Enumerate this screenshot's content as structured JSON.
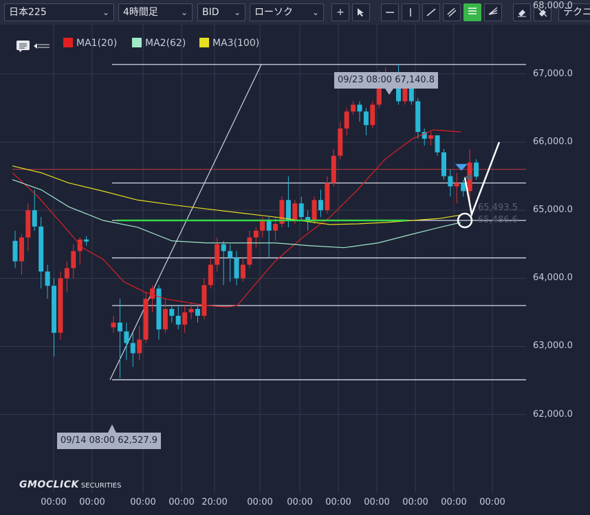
{
  "toolbar": {
    "symbol": "日本225",
    "timeframe": "4時間足",
    "price_side": "BID",
    "chart_type": "ローソク",
    "right_cut_label": "テクニ"
  },
  "legend": {
    "ma1": "MA1(20)",
    "ma2": "MA2(62)",
    "ma3": "MA3(100)"
  },
  "colors": {
    "background": "#1d2235",
    "toolbar": "#262b3d",
    "up": "#e03030",
    "down": "#29b8d8",
    "ma1": "#e02020",
    "ma2": "#a0e8c8",
    "ma3": "#e6e020",
    "horizontal_line": "#d8dce6",
    "current_price_line": "#c03a3a",
    "green_line": "#39d84a",
    "grid": "#353b4f"
  },
  "callouts": {
    "high": "09/23 08:00 67,140.8",
    "low": "09/14 08:00 62,527.9"
  },
  "price_labels": {
    "upper": "65,493.5",
    "lower": "65,486.6"
  },
  "brand": {
    "name": "GMOCLICK",
    "suffix": "SECURITIES"
  },
  "chart_data": {
    "type": "candlestick",
    "y_ticks": [
      "68,000.0",
      "67,000.0",
      "66,000.0",
      "65,000.0",
      "64,000.0",
      "63,000.0",
      "62,000.0"
    ],
    "x_ticks": [
      "00:00",
      "00:00",
      "00:00",
      "00:00",
      "20:00",
      "00:00",
      "00:00",
      "00:00",
      "00:00",
      "00:00",
      "00:00",
      "00:00"
    ],
    "ylim": [
      61800,
      68150
    ],
    "horizontal_lines": [
      67140.8,
      65400,
      64850,
      64300,
      63600,
      62510
    ],
    "current_price": 65600,
    "candles": [
      [
        64550,
        64250,
        64700,
        64150
      ],
      [
        64250,
        64600,
        64650,
        64050
      ],
      [
        64600,
        65000,
        65100,
        64400
      ],
      [
        65000,
        64760,
        65300,
        64700
      ],
      [
        64760,
        64100,
        64900,
        63850
      ],
      [
        64100,
        63890,
        64200,
        63700
      ],
      [
        63890,
        63200,
        64000,
        62850
      ],
      [
        63200,
        64000,
        64100,
        63100
      ],
      [
        64000,
        64150,
        64250,
        63800
      ],
      [
        64150,
        64400,
        64500,
        64000
      ],
      [
        64400,
        64570,
        64600,
        64200
      ],
      [
        64570,
        64540,
        64620,
        64480
      ],
      [
        63280,
        63350,
        63450,
        63200
      ],
      [
        63350,
        63220,
        63700,
        62530
      ],
      [
        63220,
        63050,
        63350,
        62800
      ],
      [
        63050,
        62900,
        63200,
        62700
      ],
      [
        62900,
        63100,
        63300,
        62800
      ],
      [
        63100,
        63700,
        63800,
        63050
      ],
      [
        63700,
        63850,
        63900,
        63500
      ],
      [
        63850,
        63250,
        63900,
        63100
      ],
      [
        63250,
        63550,
        63700,
        63200
      ],
      [
        63550,
        63450,
        63600,
        63350
      ],
      [
        63450,
        63320,
        63600,
        63250
      ],
      [
        63320,
        63500,
        63600,
        63200
      ],
      [
        63500,
        63550,
        63650,
        63400
      ],
      [
        63550,
        63450,
        63600,
        63350
      ],
      [
        63450,
        63900,
        64000,
        63400
      ],
      [
        63900,
        64200,
        64300,
        63850
      ],
      [
        64200,
        64500,
        64600,
        64100
      ],
      [
        64500,
        64400,
        64550,
        63900
      ],
      [
        64400,
        64300,
        64500,
        63950
      ],
      [
        64300,
        64000,
        64400,
        63900
      ],
      [
        64000,
        64200,
        64300,
        63950
      ],
      [
        64200,
        64600,
        64700,
        64150
      ],
      [
        64600,
        64700,
        64750,
        64450
      ],
      [
        64700,
        64850,
        64900,
        64600
      ],
      [
        64850,
        64700,
        64900,
        64300
      ],
      [
        64700,
        64800,
        64900,
        64550
      ],
      [
        64800,
        65150,
        65200,
        64750
      ],
      [
        65150,
        64850,
        65500,
        64750
      ],
      [
        64850,
        65100,
        65150,
        64800
      ],
      [
        65100,
        64900,
        65200,
        64850
      ],
      [
        64900,
        64850,
        65000,
        64700
      ],
      [
        64850,
        65150,
        65200,
        64800
      ],
      [
        65150,
        65000,
        65300,
        64900
      ],
      [
        65000,
        65400,
        65500,
        64950
      ],
      [
        65400,
        65800,
        65900,
        65350
      ],
      [
        65800,
        66200,
        66300,
        65750
      ],
      [
        66200,
        66450,
        66500,
        66100
      ],
      [
        66450,
        66550,
        66600,
        66400
      ],
      [
        66550,
        66450,
        66600,
        66300
      ],
      [
        66450,
        66250,
        66500,
        66100
      ],
      [
        66250,
        66550,
        66600,
        66200
      ],
      [
        66550,
        66900,
        67050,
        66500
      ],
      [
        66900,
        66950,
        67100,
        66850
      ],
      [
        66950,
        66850,
        67000,
        66800
      ],
      [
        66850,
        66600,
        67140.8,
        66550
      ],
      [
        66600,
        66800,
        66850,
        66550
      ],
      [
        66800,
        66600,
        66850,
        66550
      ],
      [
        66600,
        66150,
        66650,
        66050
      ],
      [
        66150,
        66050,
        66200,
        65950
      ],
      [
        66050,
        66100,
        66150,
        65950
      ],
      [
        66100,
        65850,
        66100,
        65800
      ],
      [
        65850,
        65500,
        65900,
        65450
      ],
      [
        65500,
        65350,
        65600,
        65200
      ],
      [
        65350,
        65400,
        65550,
        65100
      ],
      [
        65400,
        65280,
        65450,
        65200
      ],
      [
        65280,
        65700,
        65900,
        65100
      ],
      [
        65700,
        65493.5,
        65750,
        65450
      ]
    ],
    "ma1": [
      [
        18,
        65550
      ],
      [
        55,
        65200
      ],
      [
        90,
        64800
      ],
      [
        120,
        64450
      ],
      [
        150,
        64280
      ],
      [
        180,
        63950
      ],
      [
        210,
        63800
      ],
      [
        240,
        63700
      ],
      [
        270,
        63650
      ],
      [
        300,
        63600
      ],
      [
        330,
        63580
      ],
      [
        345,
        63600
      ],
      [
        370,
        63900
      ],
      [
        400,
        64250
      ],
      [
        440,
        64600
      ],
      [
        480,
        64900
      ],
      [
        520,
        65300
      ],
      [
        560,
        65750
      ],
      [
        600,
        66050
      ],
      [
        630,
        66180
      ],
      [
        670,
        66150
      ]
    ],
    "ma2": [
      [
        18,
        65450
      ],
      [
        60,
        65300
      ],
      [
        100,
        65050
      ],
      [
        150,
        64850
      ],
      [
        200,
        64750
      ],
      [
        250,
        64550
      ],
      [
        300,
        64520
      ],
      [
        350,
        64520
      ],
      [
        400,
        64520
      ],
      [
        450,
        64480
      ],
      [
        500,
        64450
      ],
      [
        550,
        64520
      ],
      [
        600,
        64650
      ],
      [
        640,
        64750
      ],
      [
        670,
        64820
      ]
    ],
    "ma3": [
      [
        18,
        65650
      ],
      [
        60,
        65550
      ],
      [
        100,
        65400
      ],
      [
        150,
        65280
      ],
      [
        200,
        65150
      ],
      [
        250,
        65080
      ],
      [
        300,
        65020
      ],
      [
        350,
        64960
      ],
      [
        400,
        64900
      ],
      [
        450,
        64830
      ],
      [
        480,
        64790
      ],
      [
        520,
        64800
      ],
      [
        560,
        64820
      ],
      [
        600,
        64850
      ],
      [
        640,
        64880
      ],
      [
        670,
        64930
      ]
    ]
  }
}
